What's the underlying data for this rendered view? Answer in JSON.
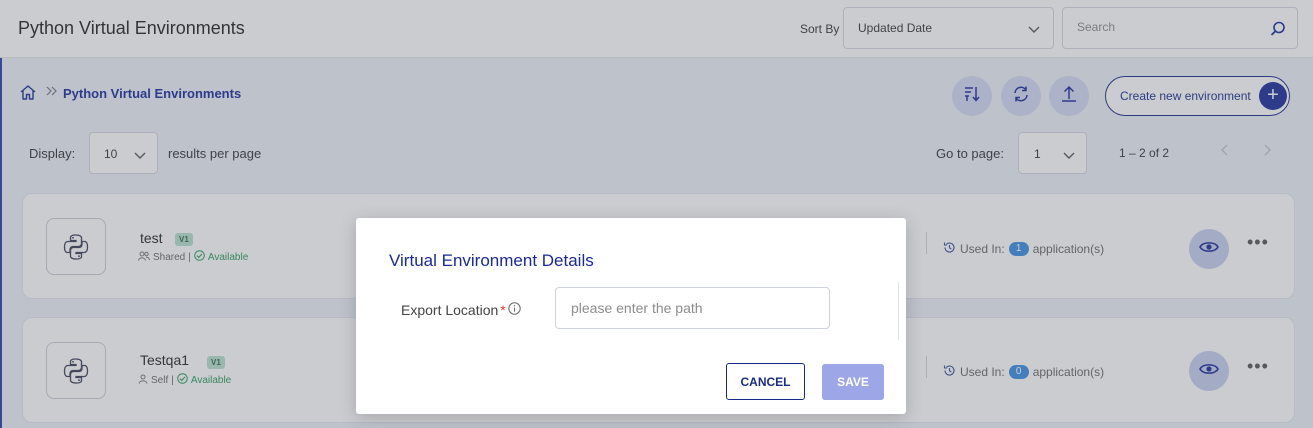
{
  "header": {
    "title": "Python Virtual Environments",
    "sort_label": "Sort By",
    "sort_value": "Updated Date",
    "search_placeholder": "Search"
  },
  "breadcrumb": {
    "current": "Python Virtual Environments"
  },
  "toolbar": {
    "create_label": "Create new environment"
  },
  "pagination": {
    "display_label": "Display:",
    "per_page": "10",
    "per_page_suffix": "results per page",
    "goto_label": "Go to page:",
    "page": "1",
    "range": "1 – 2 of 2"
  },
  "environments": [
    {
      "name": "test",
      "version": "V1",
      "scope": "Shared",
      "status": "Available",
      "used_in_label": "Used In:",
      "used_count": "1",
      "used_suffix": "application(s)"
    },
    {
      "name": "Testqa1",
      "version": "V1",
      "scope": "Self",
      "status": "Available",
      "used_in_label": "Used In:",
      "used_count": "0",
      "used_suffix": "application(s)"
    }
  ],
  "modal": {
    "title": "Virtual Environment Details",
    "field_label": "Export Location",
    "required_mark": "*",
    "path_placeholder": "please enter the path",
    "cancel_label": "CANCEL",
    "save_label": "SAVE"
  },
  "colors": {
    "accent": "#1a2a9a",
    "save_disabled": "#9da6e6",
    "available": "#2a9a5a",
    "count_badge": "#3a8ee0"
  }
}
